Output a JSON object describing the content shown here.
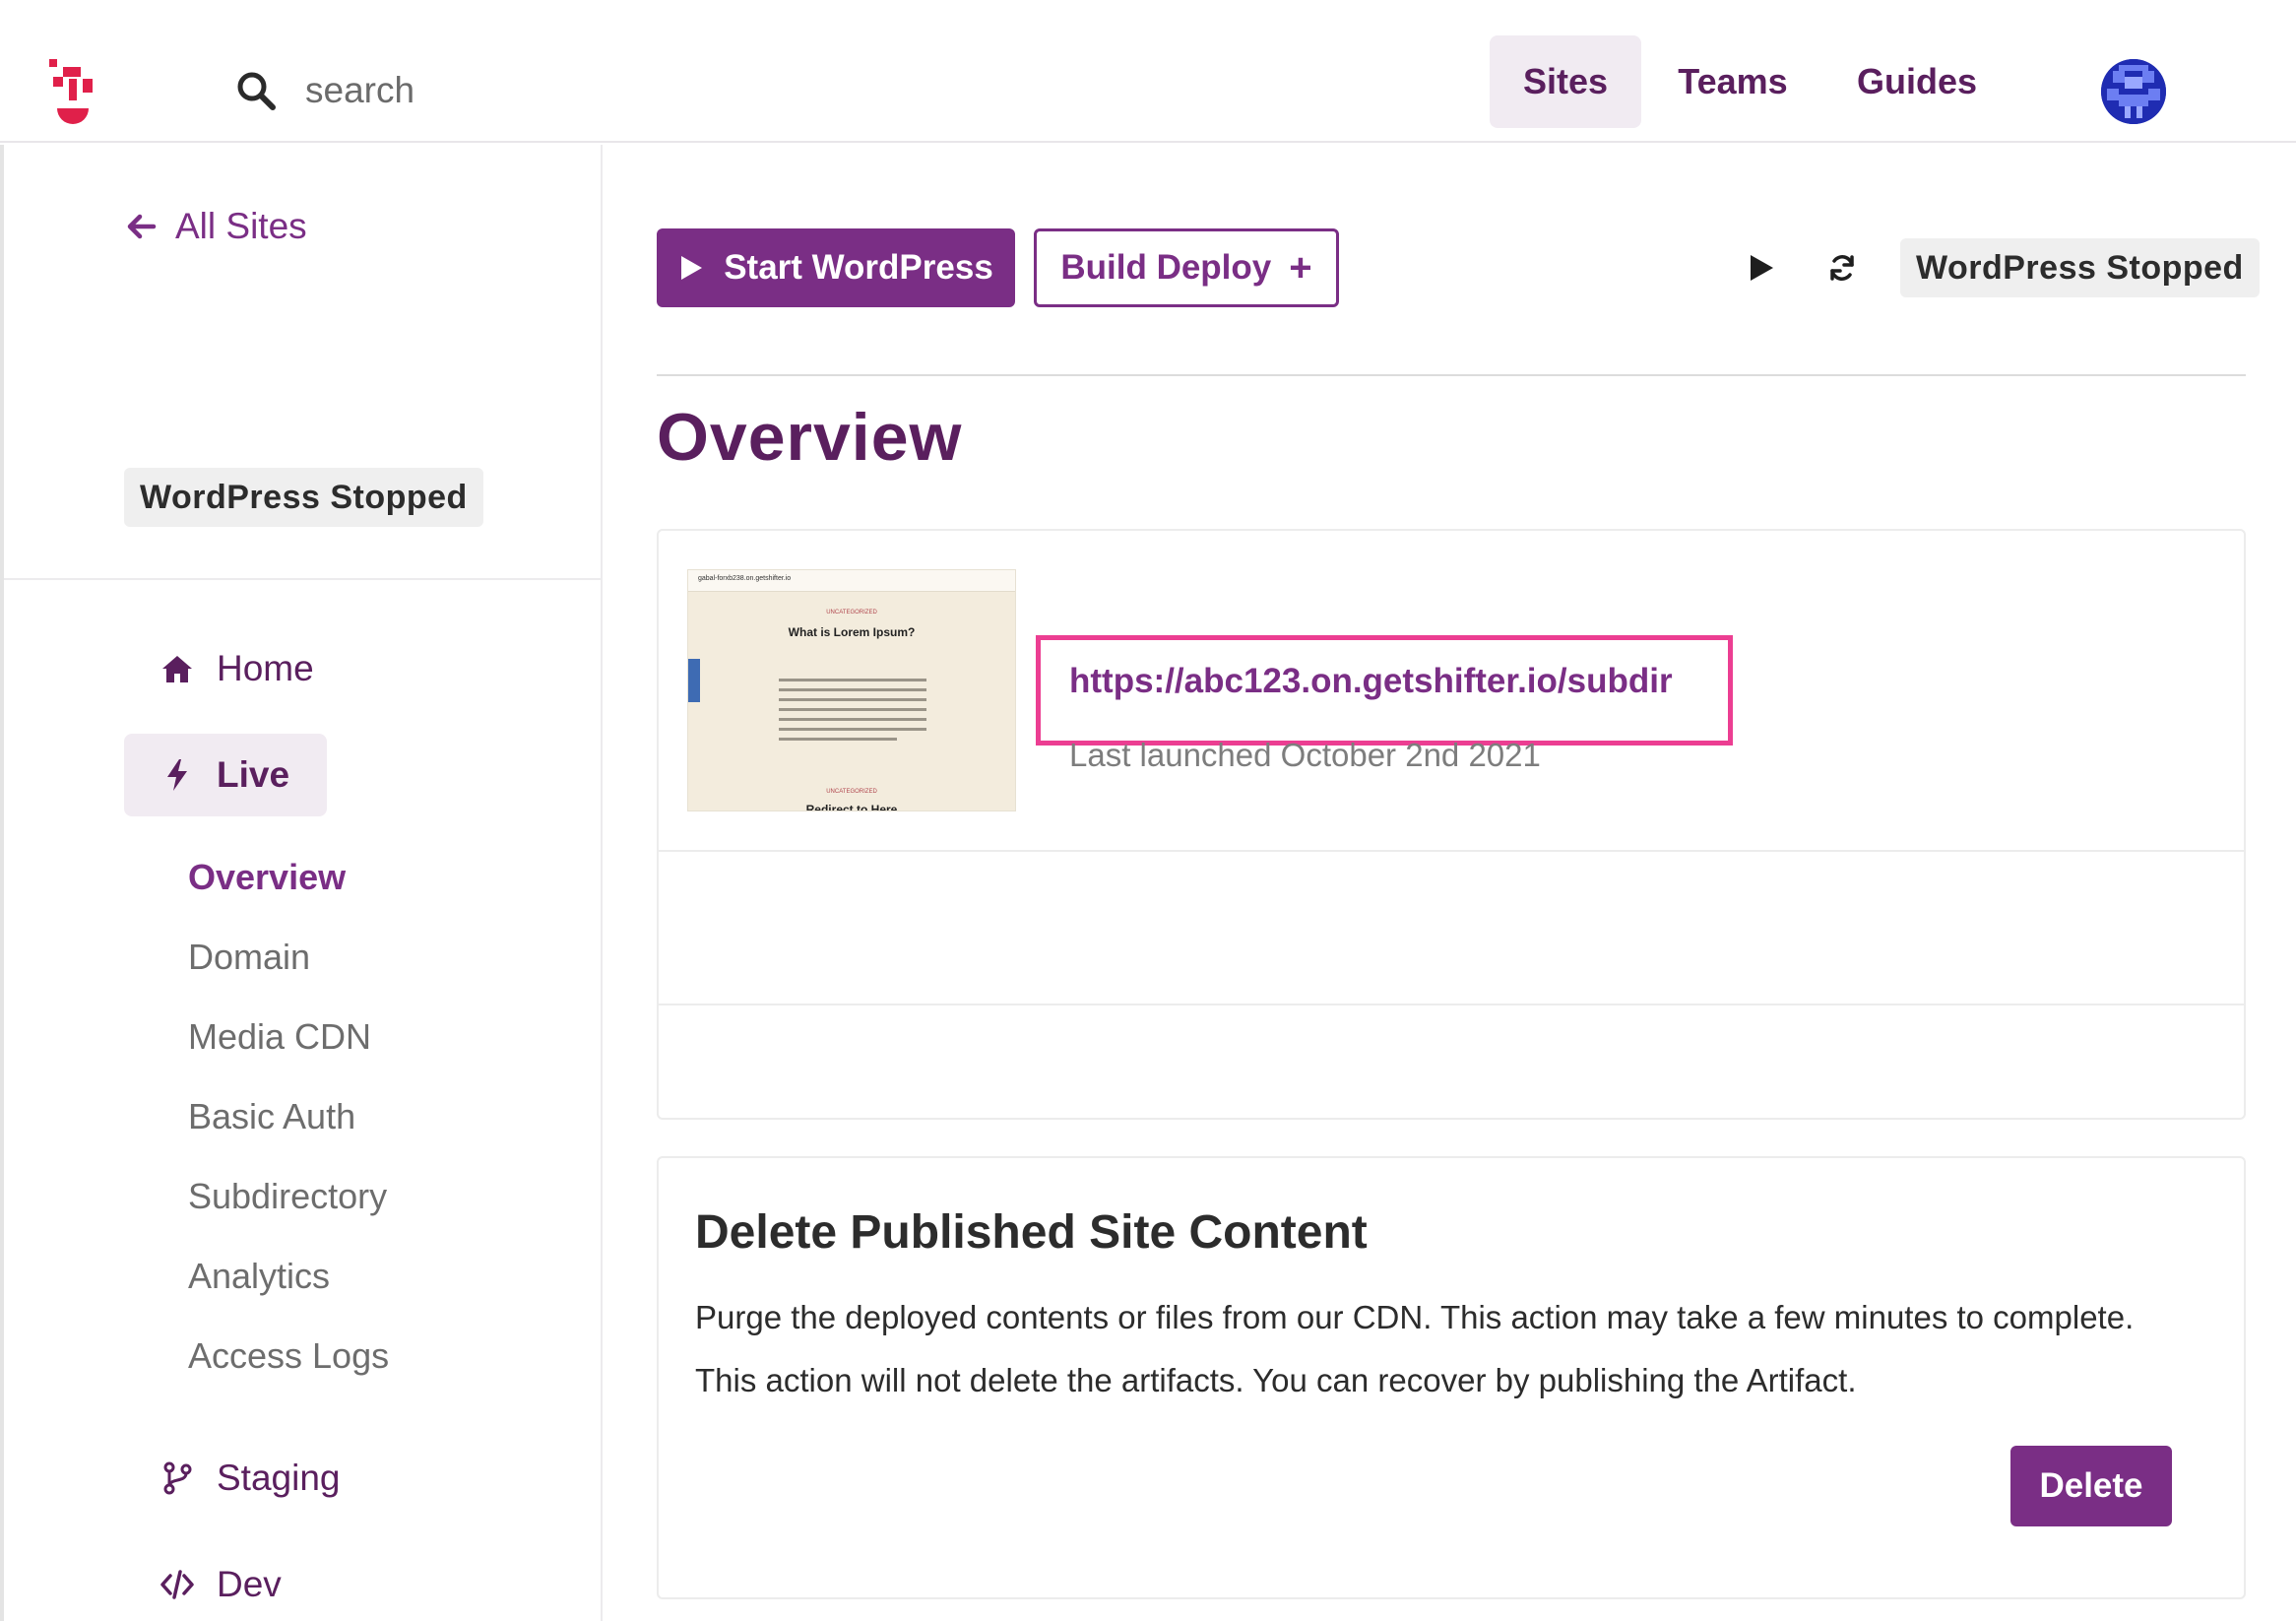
{
  "header": {
    "search": {
      "placeholder": "search"
    },
    "nav": [
      {
        "label": "Sites",
        "active": true
      },
      {
        "label": "Teams",
        "active": false
      },
      {
        "label": "Guides",
        "active": false
      }
    ],
    "icons": {
      "logo": "shifter-logo",
      "search": "search-icon",
      "avatar": "user-avatar"
    }
  },
  "sidebar": {
    "back_label": "All Sites",
    "status": "WordPress Stopped",
    "nav": {
      "home": "Home",
      "live": "Live",
      "staging": "Staging",
      "dev": "Dev"
    },
    "live_subnav": [
      {
        "label": "Overview",
        "active": true
      },
      {
        "label": "Domain",
        "active": false
      },
      {
        "label": "Media CDN",
        "active": false
      },
      {
        "label": "Basic Auth",
        "active": false
      },
      {
        "label": "Subdirectory",
        "active": false
      },
      {
        "label": "Analytics",
        "active": false
      },
      {
        "label": "Access Logs",
        "active": false
      }
    ]
  },
  "toolbar": {
    "start_label": "Start WordPress",
    "build_label": "Build Deploy",
    "build_plus": "+",
    "status": "WordPress Stopped"
  },
  "main": {
    "title": "Overview",
    "site": {
      "url": "https://abc123.on.getshifter.io/subdir",
      "last_launched": "Last launched October 2nd 2021",
      "thumbnail": {
        "bar_text": "gabal-forxb238.on.getshifter.io",
        "category": "UNCATEGORIZED",
        "post_title": "What is Lorem Ipsum?",
        "second_title": "Redirect to Here"
      }
    },
    "delete_section": {
      "title": "Delete Published Site Content",
      "line1": "Purge the deployed contents or files from our CDN. This action may take a few minutes to complete.",
      "line2": "This action will not delete the artifacts. You can recover by publishing the Artifact.",
      "button": "Delete"
    }
  },
  "colors": {
    "brand_purple": "#7a2e85",
    "dark_purple": "#5a1f5e",
    "highlight_pink": "#ec3e92",
    "logo_red": "#e0204a"
  }
}
